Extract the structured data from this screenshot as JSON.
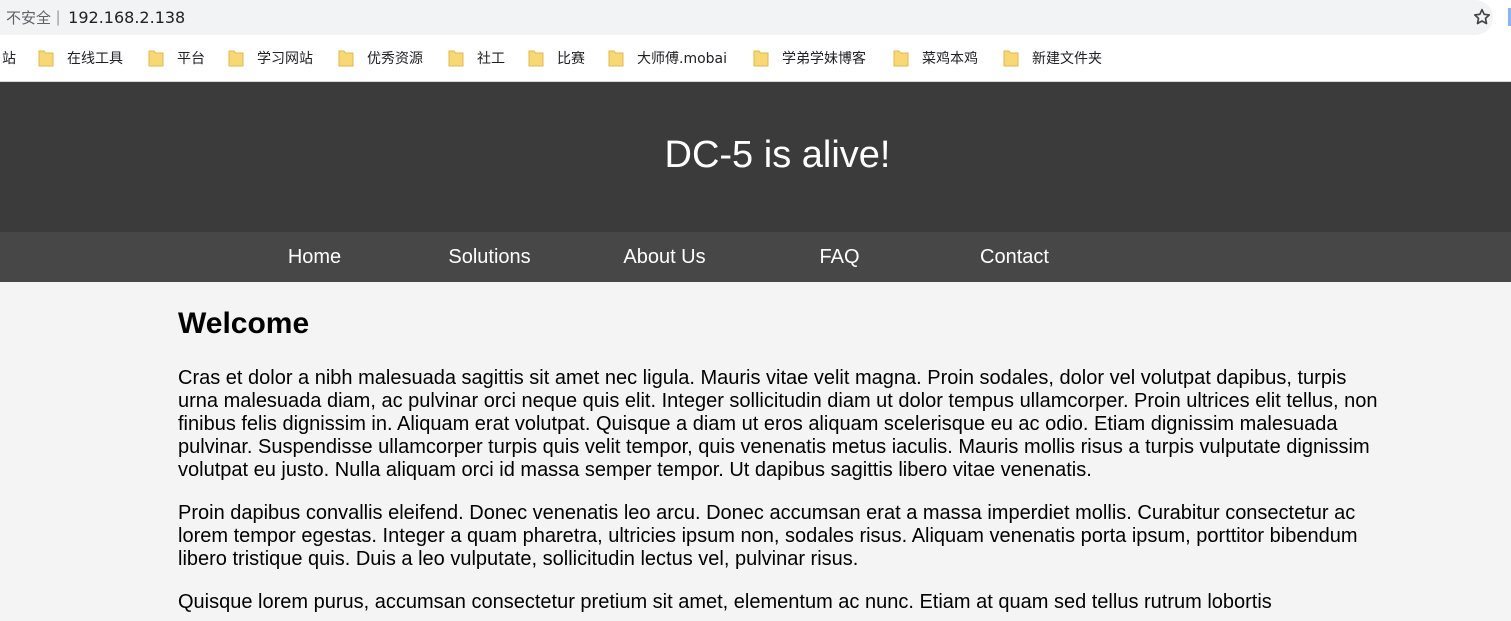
{
  "browser": {
    "security_label": "不安全",
    "separator": "|",
    "url": "192.168.2.138",
    "bookmarks_overflow": "站",
    "bookmarks": [
      {
        "label": "在线工具",
        "icon": "folder-icon"
      },
      {
        "label": "平台",
        "icon": "folder-icon"
      },
      {
        "label": "学习网站",
        "icon": "folder-icon"
      },
      {
        "label": "优秀资源",
        "icon": "folder-icon"
      },
      {
        "label": "社工",
        "icon": "folder-icon"
      },
      {
        "label": "比赛",
        "icon": "folder-icon"
      },
      {
        "label": "大师傅.mobai",
        "icon": "folder-icon"
      },
      {
        "label": "学弟学妹博客",
        "icon": "folder-icon"
      },
      {
        "label": "菜鸡本鸡",
        "icon": "folder-icon"
      },
      {
        "label": "新建文件夹",
        "icon": "folder-icon"
      }
    ]
  },
  "site": {
    "title": "DC-5 is alive!",
    "nav": [
      "Home",
      "Solutions",
      "About Us",
      "FAQ",
      "Contact"
    ]
  },
  "main": {
    "heading": "Welcome",
    "paragraphs": [
      "Cras et dolor a nibh malesuada sagittis sit amet nec ligula. Mauris vitae velit magna. Proin sodales, dolor vel volutpat dapibus, turpis urna malesuada diam, ac pulvinar orci neque quis elit. Integer sollicitudin diam ut dolor tempus ullamcorper. Proin ultrices elit tellus, non finibus felis dignissim in. Aliquam erat volutpat. Quisque a diam ut eros aliquam scelerisque eu ac odio. Etiam dignissim malesuada pulvinar. Suspendisse ullamcorper turpis quis velit tempor, quis venenatis metus iaculis. Mauris mollis risus a turpis vulputate dignissim volutpat eu justo. Nulla aliquam orci id massa semper tempor. Ut dapibus sagittis libero vitae venenatis.",
      "Proin dapibus convallis eleifend. Donec venenatis leo arcu. Donec accumsan erat a massa imperdiet mollis. Curabitur consectetur ac lorem tempor egestas. Integer a quam pharetra, ultricies ipsum non, sodales risus. Aliquam venenatis porta ipsum, porttitor bibendum libero tristique quis. Duis a leo vulputate, sollicitudin lectus vel, pulvinar risus.",
      "Quisque lorem purus, accumsan consectetur pretium sit amet, elementum ac nunc. Etiam at quam sed tellus rutrum lobortis"
    ]
  },
  "colors": {
    "header_bg": "#3b3b3b",
    "nav_bg": "#474747",
    "page_bg": "#f4f4f4",
    "folder": "#f8d775"
  }
}
